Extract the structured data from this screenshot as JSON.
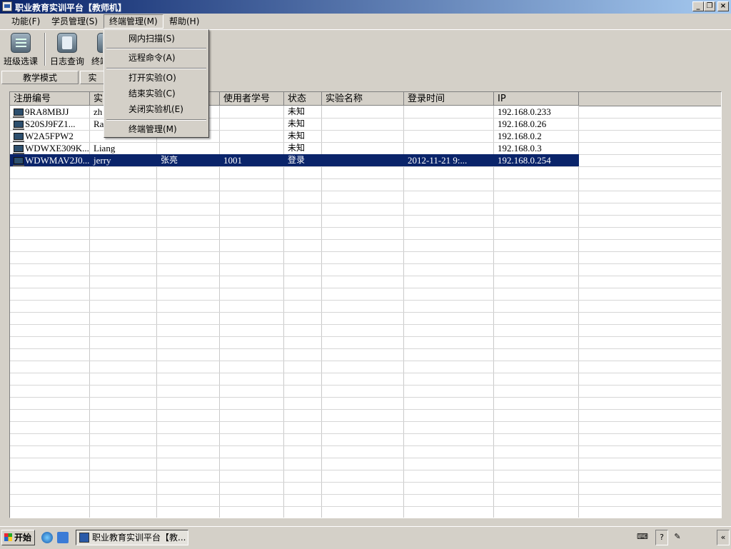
{
  "window": {
    "title": "职业教育实训平台【教师机】",
    "min_icon": "_",
    "max_icon": "❐",
    "close_icon": "×"
  },
  "menubar": {
    "items": [
      "功能(F)",
      "学员管理(S)",
      "终端管理(M)",
      "帮助(H)"
    ]
  },
  "toolbar": {
    "items": [
      {
        "label": "班级选课",
        "icon": "list-icon"
      },
      {
        "label": "日志查询",
        "icon": "log-icon"
      },
      {
        "label": "终端",
        "icon": "terminal-icon"
      }
    ]
  },
  "tabs": [
    "教学模式",
    "实"
  ],
  "dropdown": {
    "items": [
      "网内扫描(S)",
      "远程命令(A)",
      "打开实验(O)",
      "结束实验(C)",
      "关闭实验机(E)",
      "终端管理(M)"
    ]
  },
  "grid": {
    "columns": [
      "注册编号",
      "实",
      "",
      "使用者学号",
      "状态",
      "实验名称",
      "登录时间",
      "IP"
    ],
    "rows": [
      {
        "id": "9RA8MBJJ",
        "name": "zh",
        "real": "",
        "sno": "",
        "status": "未知",
        "exp": "",
        "login": "",
        "ip": "192.168.0.233"
      },
      {
        "id": "S20SJ9FZ1...",
        "name": "Ra",
        "real": "",
        "sno": "",
        "status": "未知",
        "exp": "",
        "login": "",
        "ip": "192.168.0.26"
      },
      {
        "id": "W2A5FPW2",
        "name": "",
        "real": "",
        "sno": "",
        "status": "未知",
        "exp": "",
        "login": "",
        "ip": "192.168.0.2"
      },
      {
        "id": "WDWXE309K...",
        "name": "Liang",
        "real": "",
        "sno": "",
        "status": "未知",
        "exp": "",
        "login": "",
        "ip": "192.168.0.3"
      },
      {
        "id": "WDWMAV2J0...",
        "name": "jerry",
        "real": "张亮",
        "sno": "1001",
        "status": "登录",
        "exp": "",
        "login": "2012-11-21 9:...",
        "ip": "192.168.0.254",
        "selected": true
      }
    ]
  },
  "taskbar": {
    "start": "开始",
    "task": "职业教育实训平台【教...",
    "tray_help": "?",
    "tray_arrow": "«"
  }
}
